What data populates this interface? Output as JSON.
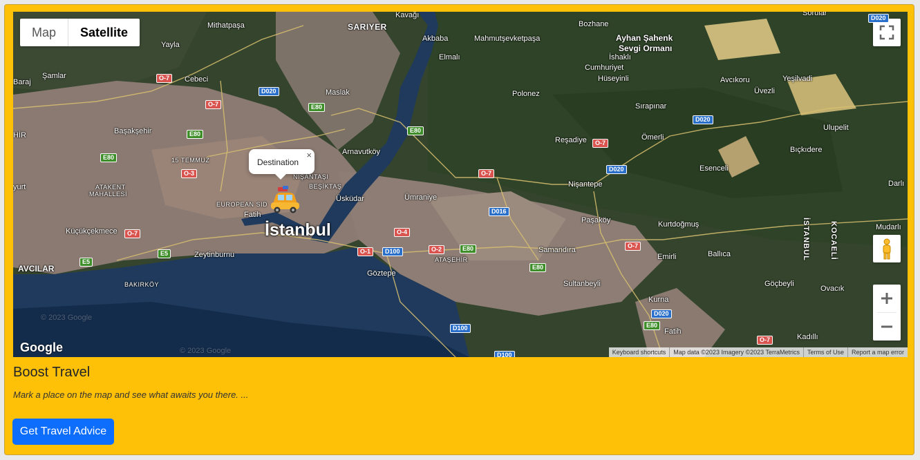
{
  "map": {
    "type_buttons": {
      "map": "Map",
      "satellite": "Satellite"
    },
    "active_type": "Satellite",
    "popup_text": "Destination",
    "popup_close": "×",
    "city_label": "İstanbul",
    "google_logo": "Google",
    "attribution": {
      "keyboard": "Keyboard shortcuts",
      "map_data": "Map data ©2023 Imagery ©2023 TerraMetrics",
      "terms": "Terms of Use",
      "report": "Report a map error"
    },
    "places": {
      "kavagi": "Kavağı",
      "sariyer": "SARIYER",
      "mithatpasa": "Mithatpaşa",
      "yayla": "Yayla",
      "akbaba": "Akbaba",
      "mahmutsevketpasa": "Mahmutşevketpaşa",
      "elmali": "Elmalı",
      "bozhane": "Bozhane",
      "ayhan": "Ayhan Şahenk",
      "sevgi": "Sevgi Ormanı",
      "ishakli": "İshaklı",
      "samlar": "Şamlar",
      "cebeci": "Cebeci",
      "maslak": "Maslak",
      "polonez": "Polonez",
      "cumhuriyet": "Cumhuriyet",
      "huseyinli": "Hüseyinli",
      "avcikoru": "Avcıkoru",
      "yesilvadi": "Yeşilvadi",
      "uvezli": "Üvezli",
      "sirapinar": "Sırapınar",
      "basaksehir": "Başakşehir",
      "ulupelit": "Ulupelit",
      "omerli": "Ömerli",
      "resadiye": "Reşadiye",
      "bickidere": "Bıçkıdere",
      "arnavutkoy": "Arnavutköy",
      "temmuz": "15 TEMMUZ",
      "esenceli": "Esenceli",
      "nisantasi": "NİŞANTAŞI",
      "besiktas": "BEŞİKTAŞ",
      "atakent": "ATAKENT",
      "mahalle": "MAHALLESİ",
      "nisantepe": "Nişantepe",
      "darli": "Darlı",
      "uskudar": "Üsküdar",
      "umraniye": "Ümraniye",
      "european": "EUROPEAN SID",
      "fatih": "Fatih",
      "pasakoy": "Paşaköy",
      "kurtdogmus": "Kurtdoğmuş",
      "mudarli": "Mudarlı",
      "kucukcekmece": "Küçükçekmece",
      "samandira": "Samandıra",
      "ballica": "Ballıca",
      "emirli": "Emirli",
      "avcilar": "AVCILAR",
      "zeytinburnu": "Zeytinburnu",
      "atasehir": "ATAŞEHİR",
      "bakirkoy": "BAKIRKÖY",
      "goztepe": "Göztepe",
      "sultanbeyli": "Sultanbeyli",
      "gocbeyli": "Göçbeyli",
      "ovacik": "Ovacık",
      "kurna": "Kurna",
      "fatih2": "Fatih",
      "kadilli": "Kadıllı",
      "istanbul_border": "İSTANBUL",
      "kocaeli": "KOCAELİ",
      "hir": "HİR",
      "yurt": "yurt",
      "barajo": "Baraj",
      "sorular": "Sorular",
      "watermark": "© 2023 Google"
    },
    "road_signs": {
      "o7a": "O-7",
      "d020a": "D020",
      "o7b": "O-7",
      "e80a": "E80",
      "e80b": "E80",
      "e80c": "E80",
      "e80d": "E80",
      "o3": "O-3",
      "o7c": "O-7",
      "d020b": "D020",
      "d020c": "D020",
      "o7d": "O-7",
      "d016": "D016",
      "o4": "O-4",
      "o1": "O-1",
      "d100a": "D100",
      "o2": "O-2",
      "e80e": "E80",
      "e80f": "E80",
      "o7e": "O-7",
      "o7f": "O-7",
      "e5a": "E5",
      "e5b": "E5",
      "d100b": "D100",
      "d020d": "D020",
      "e80g": "E80",
      "o7g": "O-7",
      "d100c": "D100",
      "d020e": "D020"
    }
  },
  "card": {
    "title": "Boost Travel",
    "description": "Mark a place on the map and see what awaits you there. ...",
    "button": "Get Travel Advice"
  },
  "colors": {
    "card_bg": "#ffc107",
    "button_bg": "#0d6efd",
    "land": "#3a4a30",
    "urban": "#8a7a70",
    "water": "#1f3a5c"
  }
}
